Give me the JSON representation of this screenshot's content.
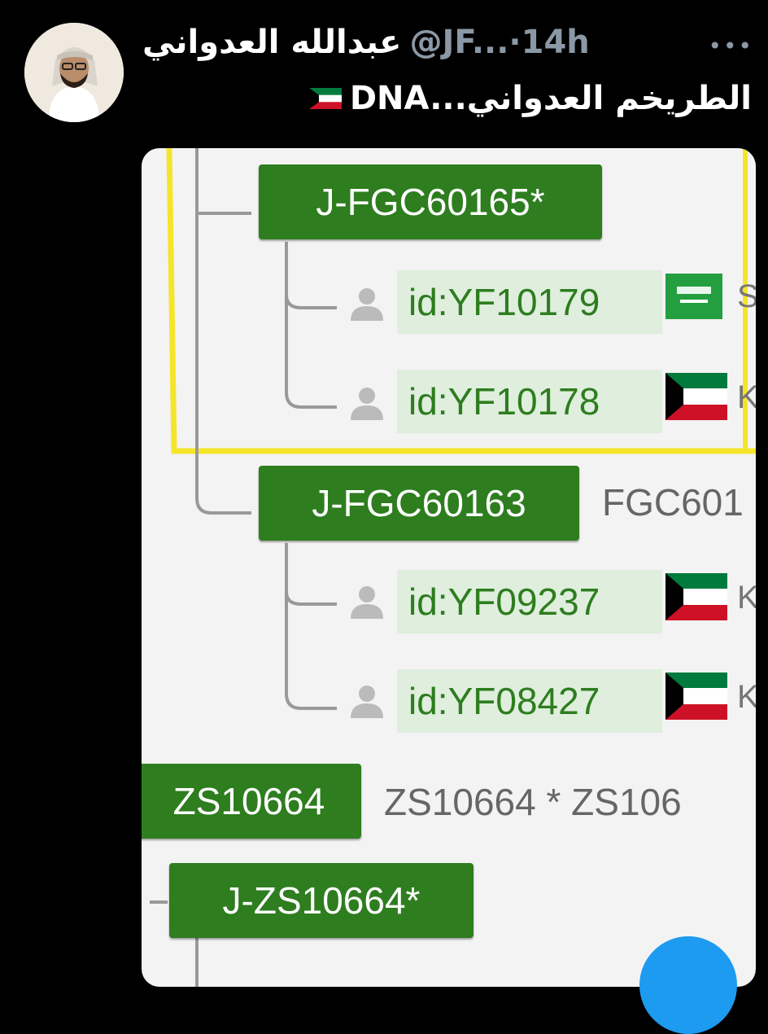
{
  "tweet": {
    "display_name": "عبدالله العدواني",
    "handle": "@JF...",
    "separator": "·",
    "timestamp": "14h",
    "more_icon": "more-horizontal-icon",
    "text": "DNA...الطريخم العدواني",
    "flag_emoji": "kuwait-flag"
  },
  "tree": {
    "nodes": [
      {
        "label": "J-FGC60165*"
      },
      {
        "label": "J-FGC60163",
        "descr": "FGC601"
      },
      {
        "label": "ZS10664",
        "descr": "ZS10664 * ZS106"
      },
      {
        "label": "J-ZS10664*"
      }
    ],
    "samples": [
      {
        "id": "id:YF10179",
        "flag": "saudi-arabia-flag",
        "cut_text": "S"
      },
      {
        "id": "id:YF10178",
        "flag": "kuwait-flag",
        "cut_text": "K"
      },
      {
        "id": "id:YF09237",
        "flag": "kuwait-flag",
        "cut_text": "K"
      },
      {
        "id": "id:YF08427",
        "flag": "kuwait-flag",
        "cut_text": "K"
      }
    ],
    "colors": {
      "node": "#2e7d1f",
      "sample_bg": "#dfeedd",
      "highlight": "#f5e52a"
    }
  }
}
